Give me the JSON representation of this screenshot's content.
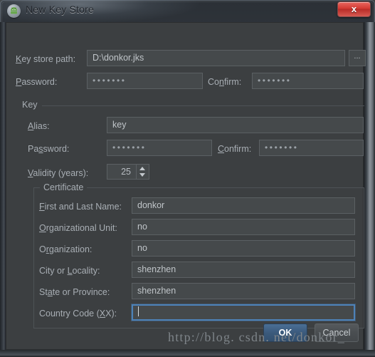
{
  "window": {
    "title": "New Key Store",
    "app_icon": "android-robot-icon",
    "close_label": "x"
  },
  "keystore": {
    "path_label": "Key store path:",
    "path_value": "D:\\donkor.jks",
    "browse_label": "...",
    "password_label": "Password:",
    "password_value": "•••••••",
    "confirm_label": "Confirm:",
    "confirm_value": "•••••••"
  },
  "key": {
    "group_label": "Key",
    "alias_label": "Alias:",
    "alias_value": "key",
    "password_label": "Password:",
    "password_value": "•••••••",
    "confirm_label": "Confirm:",
    "confirm_value": "•••••••",
    "validity_label": "Validity (years):",
    "validity_value": "25"
  },
  "certificate": {
    "legend": "Certificate",
    "fields": [
      {
        "label": "First and Last Name:",
        "value": "donkor",
        "focused": false
      },
      {
        "label": "Organizational Unit:",
        "value": "no",
        "focused": false
      },
      {
        "label": "Organization:",
        "value": "no",
        "focused": false
      },
      {
        "label": "City or Locality:",
        "value": "shenzhen",
        "focused": false
      },
      {
        "label": "State or Province:",
        "value": "shenzhen",
        "focused": false
      },
      {
        "label": "Country Code (XX):",
        "value": "",
        "focused": true
      }
    ]
  },
  "footer": {
    "ok_label": "OK",
    "cancel_label": "Cancel"
  },
  "watermark": {
    "text": "http://blog. csdn. net/donkor_"
  },
  "colors": {
    "dialog_bg": "#3c3f41",
    "field_bg": "#45494b",
    "field_border": "#5b6063",
    "label_text": "#a8aeb4",
    "focus_border": "#4d82b8",
    "ok_button": "#3b5a7c",
    "close_button": "#d33a33"
  }
}
